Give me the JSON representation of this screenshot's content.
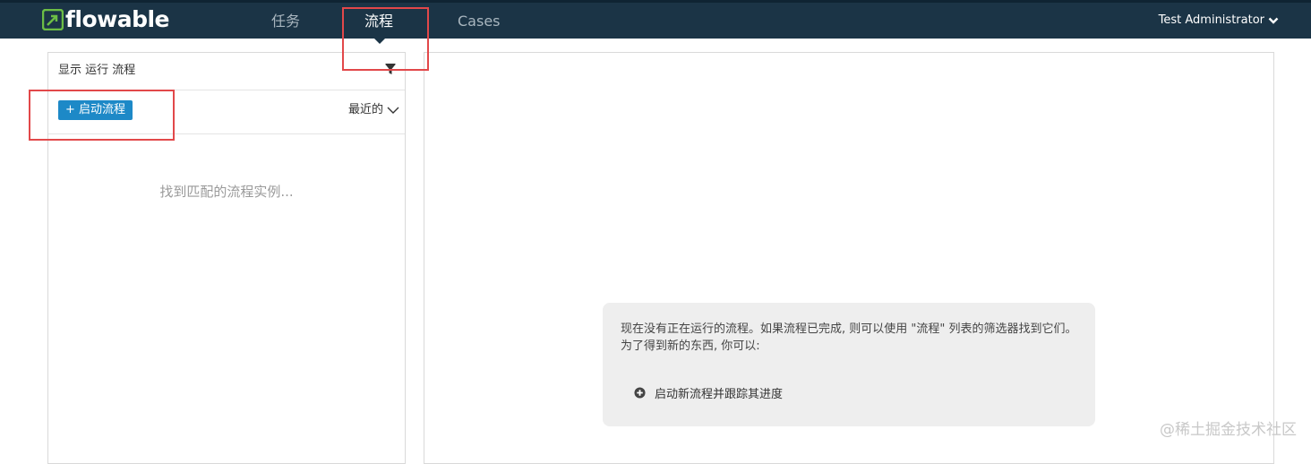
{
  "app": {
    "logo_text": "flowable"
  },
  "nav": {
    "items": [
      {
        "label": "任务"
      },
      {
        "label": "流程"
      },
      {
        "label": "Cases"
      }
    ],
    "user": "Test Administrator"
  },
  "list_panel": {
    "header": "显示 运行 流程",
    "start_button": "+ 启动流程",
    "sort_label": "最近的",
    "empty_message": "找到匹配的流程实例..."
  },
  "detail_panel": {
    "help_text": "现在没有正在运行的流程。如果流程已完成, 则可以使用 \"流程\" 列表的筛选器找到它们。为了得到新的东西, 你可以:",
    "action_label": "启动新流程并跟踪其进度"
  },
  "watermark": "@稀土掘金技术社区",
  "colors": {
    "topbar": "#1b3446",
    "logo_green": "#6cbd45",
    "primary_button": "#1d89c7",
    "highlight": "#e2484a"
  },
  "icons": {
    "filter": "filter-icon",
    "user_dropdown": "chevron-down-icon",
    "sort_dropdown": "chevron-down-icon",
    "action": "plus-circle-icon"
  }
}
